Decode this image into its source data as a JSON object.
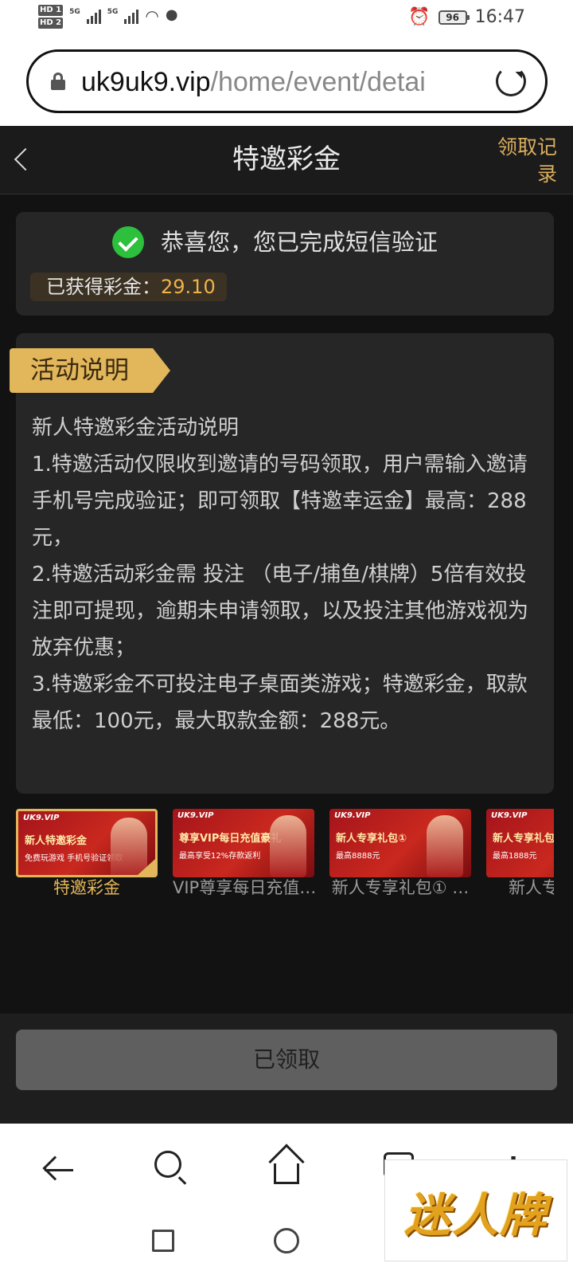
{
  "status_bar": {
    "hd1": "HD 1",
    "hd2": "HD 2",
    "net1": "5G",
    "net2": "5G",
    "battery": "96",
    "time": "16:47"
  },
  "browser": {
    "url_domain": "uk9uk9.vip",
    "url_path": "/home/event/detai"
  },
  "header": {
    "title": "特邀彩金",
    "records_label": "领取记录"
  },
  "verification": {
    "message": "恭喜您，您已完成短信验证",
    "earned_label": "已获得彩金：",
    "earned_amount": "29.10"
  },
  "activity": {
    "ribbon_label": "活动说明",
    "paragraphs": [
      "新人特邀彩金活动说明",
      "1.特邀活动仅限收到邀请的号码领取，用户需输入邀请手机号完成验证；即可领取【特邀幸运金】最高：288元，",
      "2.特邀活动彩金需 投注 （电子/捕鱼/棋牌）5倍有效投注即可提现，逾期未申请领取，以及投注其他游戏视为放弃优惠；",
      "3.特邀彩金不可投注电子桌面类游戏；特邀彩金，取款最低：100元，最大取款金额：288元。"
    ]
  },
  "events": [
    {
      "label": "特邀彩金",
      "banner_tag": "UK9.VIP",
      "banner_title": "新人特邀彩金",
      "banner_sub": "免费玩游戏 手机号验证领取",
      "selected": true
    },
    {
      "label": "VIP尊享每日充值…",
      "banner_tag": "UK9.VIP",
      "banner_title": "尊享VIP每日充值豪礼",
      "banner_sub": "最高享受12%存款返利",
      "selected": false
    },
    {
      "label": "新人专享礼包① …",
      "banner_tag": "UK9.VIP",
      "banner_title": "新人专享礼包①",
      "banner_sub": "最高8888元",
      "selected": false
    },
    {
      "label": "新人专",
      "banner_tag": "UK9.VIP",
      "banner_title": "新人专享礼包",
      "banner_sub": "最高1888元",
      "selected": false
    }
  ],
  "action": {
    "button_label": "已领取"
  },
  "watermark": {
    "text": "迷人牌"
  }
}
